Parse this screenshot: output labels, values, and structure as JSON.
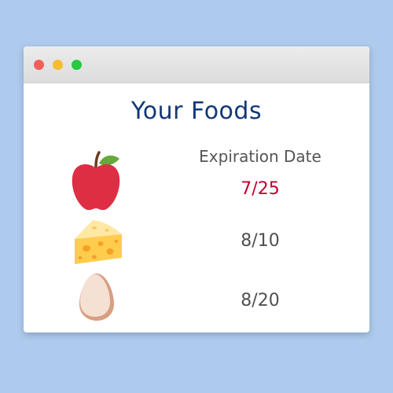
{
  "colors": {
    "background": "#aecaec",
    "title": "#113877",
    "header_text": "#555555",
    "date_text": "#505050",
    "expired_date": "#c0002f",
    "close_dot": "#f25f58",
    "minimize_dot": "#f8bc2e",
    "zoom_dot": "#28c840"
  },
  "window": {
    "buttons": [
      "close",
      "minimize",
      "zoom"
    ]
  },
  "title": "Your Foods",
  "column_header": "Expiration Date",
  "foods": [
    {
      "icon": "apple-icon",
      "date": "7/25",
      "status": "expiring-soon"
    },
    {
      "icon": "cheese-icon",
      "date": "8/10",
      "status": "ok"
    },
    {
      "icon": "egg-icon",
      "date": "8/20",
      "status": "ok"
    }
  ]
}
